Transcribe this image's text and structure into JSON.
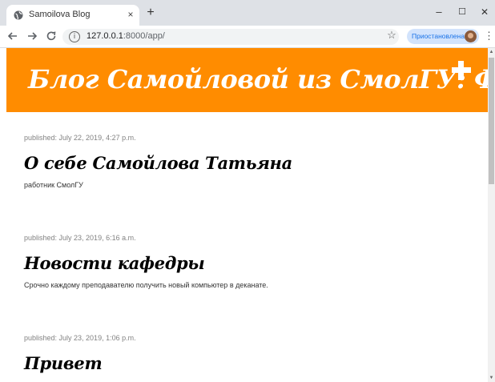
{
  "browser": {
    "tab_title": "Samoilova Blog",
    "tab_close": "×",
    "new_tab": "+",
    "url_host": "127.0.0.1",
    "url_path": ":8000/app/",
    "paused_label": "Приостановлена",
    "window_minimize": "–",
    "window_maximize": "☐",
    "window_close": "✕"
  },
  "header": {
    "blog_title": "Блог Самойловой из СмолГУ: ФИЗМАТ"
  },
  "posts": [
    {
      "published": "published: July 22, 2019, 4:27 p.m.",
      "title": "О себе Самойлова Татьяна",
      "body": "работник СмолГУ"
    },
    {
      "published": "published: July 23, 2019, 6:16 a.m.",
      "title": "Новости кафедры",
      "body": "Срочно каждому преподавателю получить новый компьютер в деканате."
    },
    {
      "published": "published: July 23, 2019, 1:06 p.m.",
      "title": "Привет",
      "body": ""
    }
  ],
  "colors": {
    "header_bg": "#ff8c00",
    "accent_text": "#ffffff"
  },
  "icons": {
    "favicon": "globe-icon",
    "back": "arrow-left-icon",
    "forward": "arrow-right-icon",
    "reload": "reload-icon",
    "info": "info-icon",
    "bookmark": "star-icon",
    "menu": "kebab-menu-icon",
    "new_post": "plus-icon"
  }
}
